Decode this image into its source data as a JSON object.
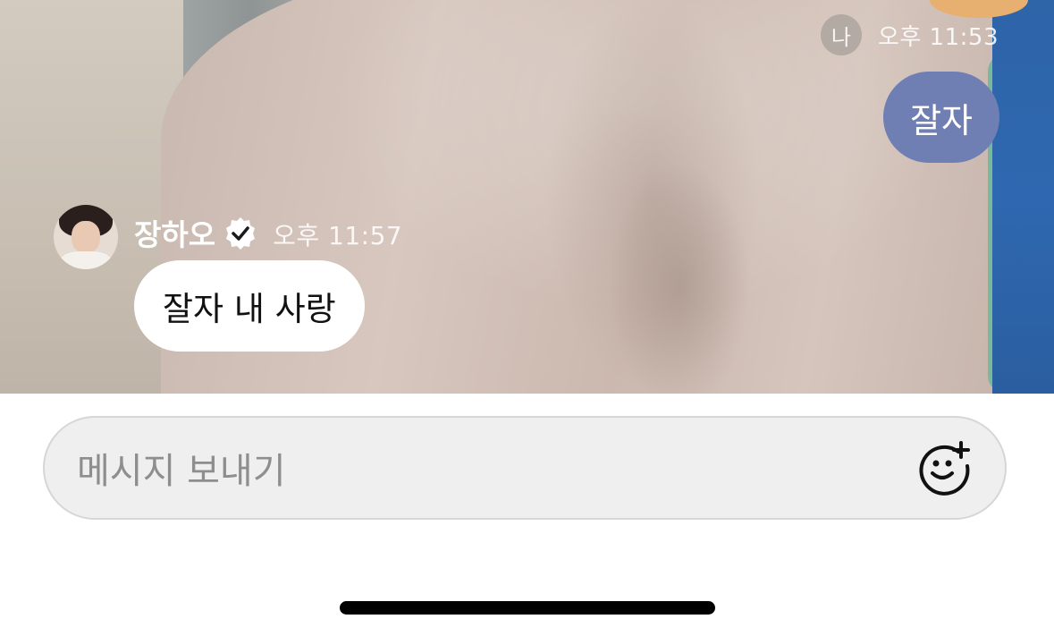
{
  "chat": {
    "my_message": {
      "avatar_label": "나",
      "time": "오후 11:53",
      "text": "잘자",
      "bubble_color": "#6f7fb4"
    },
    "their_message": {
      "sender_name": "장하오",
      "verified_icon": "verified-badge-icon",
      "time": "오후 11:57",
      "text": "잘자 내 사랑",
      "bubble_color": "#ffffff"
    }
  },
  "composer": {
    "placeholder": "메시지 보내기",
    "emoji_icon": "add-emoji-icon"
  }
}
